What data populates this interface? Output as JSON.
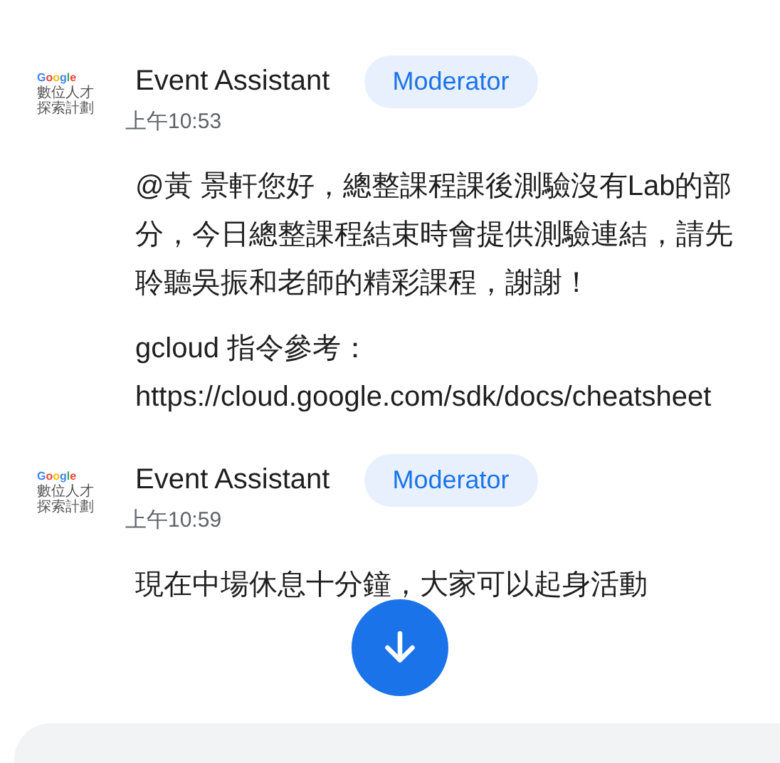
{
  "messages": [
    {
      "avatar": {
        "logo": "Google",
        "lines": [
          "數位人才",
          "探索計劃"
        ]
      },
      "sender": "Event Assistant",
      "badge": "Moderator",
      "time": "上午10:53",
      "body": [
        {
          "kind": "text",
          "text": "@黃 景軒您好，總整課程課後測驗沒有Lab的部分，今日總整課程結束時會提供測驗連結，請先聆聽吳振和老師的精彩課程，謝謝！"
        },
        {
          "kind": "url",
          "text": "gcloud 指令參考：",
          "url": "https://cloud.google.com/sdk/docs/cheatsheet"
        }
      ]
    },
    {
      "avatar": {
        "logo": "Google",
        "lines": [
          "數位人才",
          "探索計劃"
        ]
      },
      "sender": "Event Assistant",
      "badge": "Moderator",
      "time": "上午10:59",
      "body": [
        {
          "kind": "text",
          "text": "現在中場休息十分鐘，大家可以起身活動"
        }
      ]
    }
  ]
}
